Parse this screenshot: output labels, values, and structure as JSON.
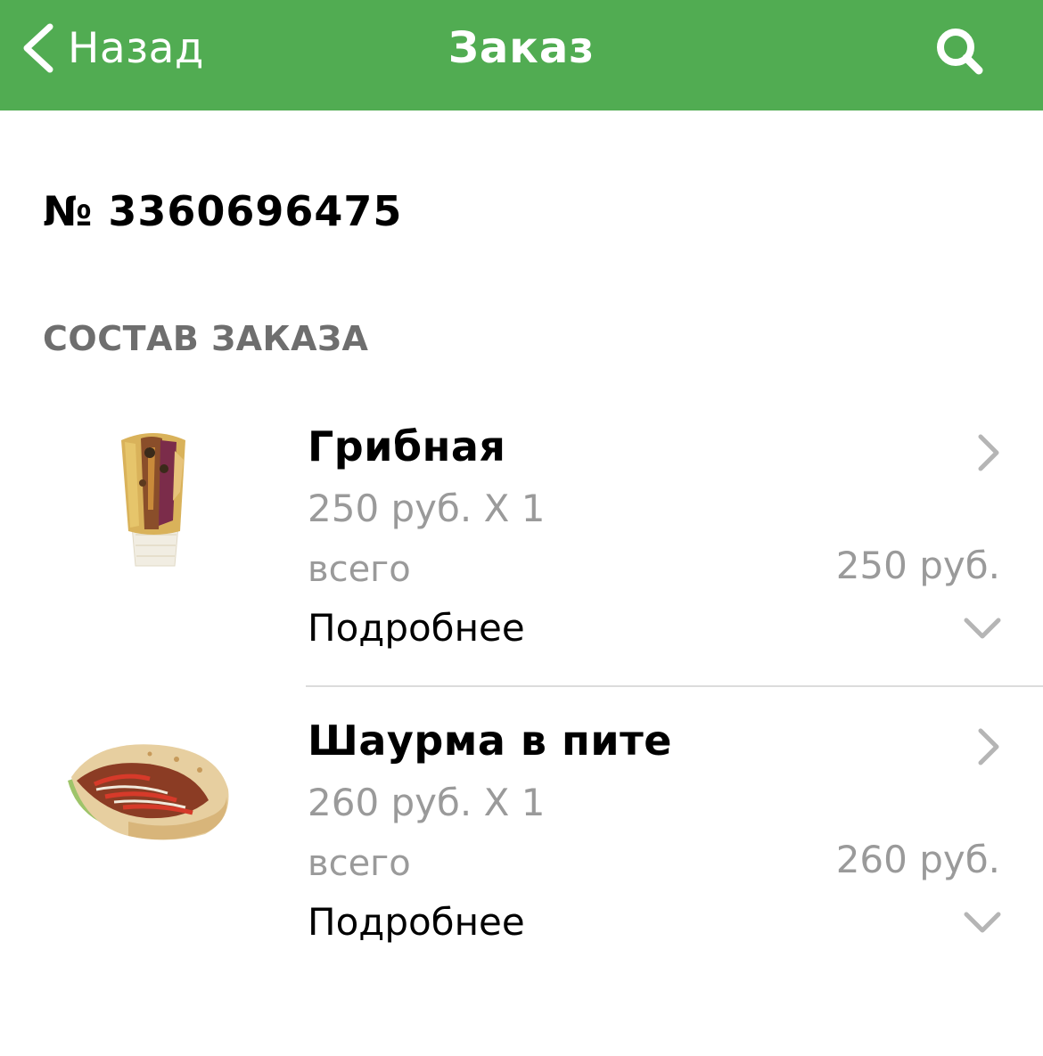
{
  "nav": {
    "back_label": "Назад",
    "title": "Заказ",
    "search_icon": "search-icon",
    "back_icon": "chevron-left-icon",
    "bar_color": "#51ac52"
  },
  "order": {
    "number": "№ 3360696475"
  },
  "section": {
    "title": "СОСТАВ ЗАКАЗА"
  },
  "items": [
    {
      "name": "Грибная",
      "price_line": "250 руб. Х 1",
      "total_label": "всего",
      "total": "250 руб.",
      "more_label": "Подробнее"
    },
    {
      "name": "Шаурма в пите",
      "price_line": "260 руб. Х 1",
      "total_label": "всего",
      "total": "260 руб.",
      "more_label": "Подробнее"
    }
  ]
}
